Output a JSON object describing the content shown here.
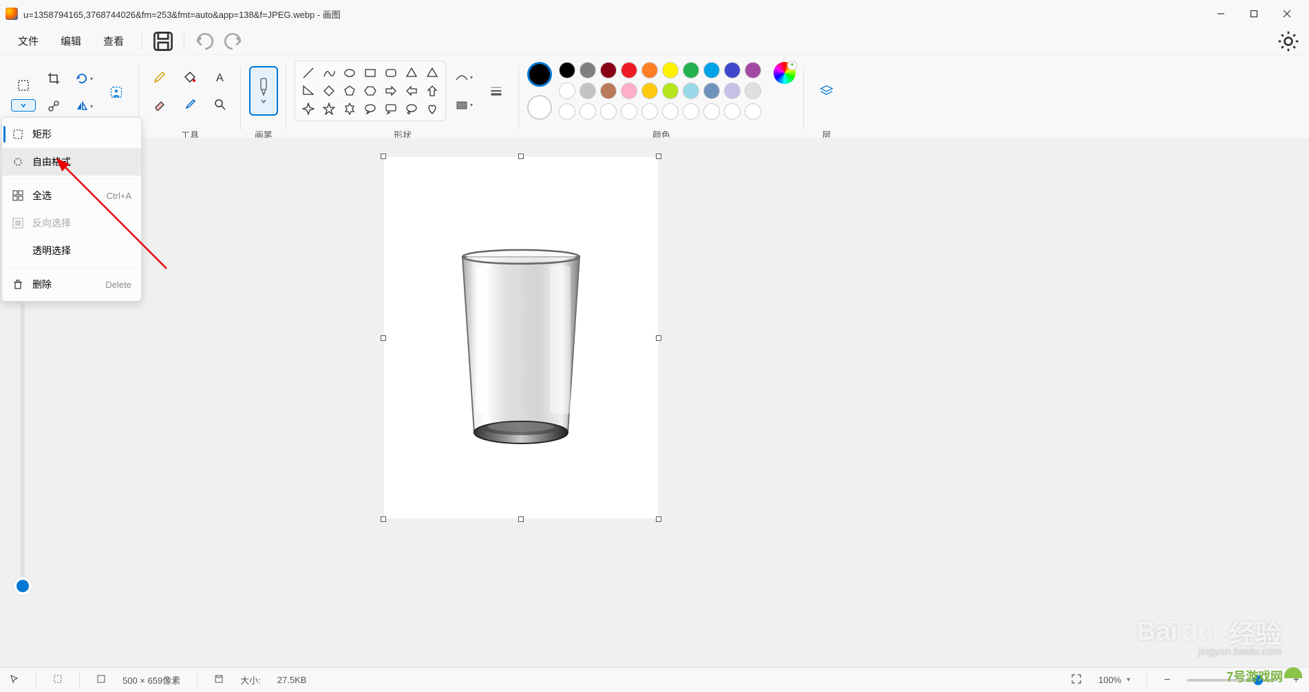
{
  "title": "u=1358794165,3768744026&fm=253&fmt=auto&app=138&f=JPEG.webp - 画图",
  "menu": {
    "file": "文件",
    "edit": "编辑",
    "view": "查看"
  },
  "ribbon": {
    "tools_label": "工具",
    "brushes_label": "画笔",
    "shapes_label": "形状",
    "colors_label": "颜色",
    "layers_label": "层"
  },
  "dropdown": {
    "rectangle": "矩形",
    "freeform": "自由格式",
    "select_all": "全选",
    "select_all_shortcut": "Ctrl+A",
    "invert": "反向选择",
    "transparent": "透明选择",
    "delete": "删除",
    "delete_shortcut": "Delete"
  },
  "colors": {
    "row1": [
      "#000000",
      "#7f7f7f",
      "#880015",
      "#ed1c24",
      "#ff7f27",
      "#fff200",
      "#22b14c",
      "#00a2e8",
      "#3f48cc",
      "#a349a4"
    ],
    "row2": [
      "#ffffff",
      "#c3c3c3",
      "#b97a57",
      "#ffaec9",
      "#ffc90e",
      "#b5e61d",
      "#99d9ea",
      "#7092be",
      "#c8bfe7",
      "#e0e0e0"
    ],
    "row3": [
      "#ffffff",
      "#ffffff",
      "#ffffff",
      "#ffffff",
      "#ffffff",
      "#ffffff",
      "#ffffff",
      "#ffffff",
      "#ffffff",
      "#ffffff"
    ]
  },
  "status": {
    "dimensions": "500 × 659像素",
    "size_label": "大小:",
    "size_value": "27.5KB",
    "zoom": "100%"
  },
  "watermark": {
    "brand": "Bai",
    "brand2": "经验",
    "url": "jingyan.baidu.com",
    "game": "7号游戏网"
  }
}
